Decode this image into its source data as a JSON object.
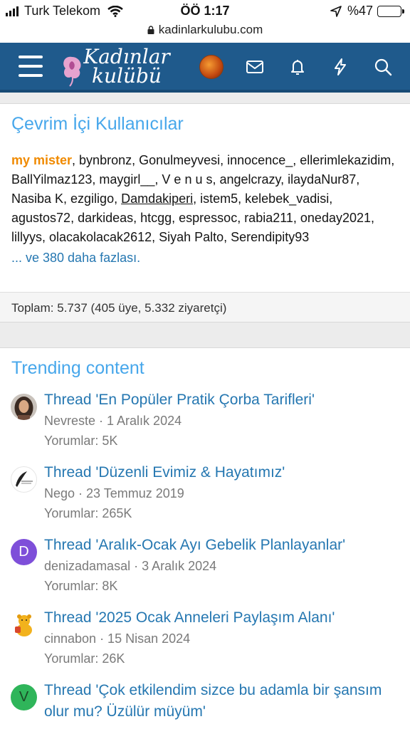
{
  "status_bar": {
    "carrier": "Turk Telekom",
    "time": "ÖÖ 1:17",
    "battery": "%47",
    "battery_level": 0.47
  },
  "browser": {
    "url": "kadinlarkulubu.com"
  },
  "header": {
    "logo_line1": "Kadınlar",
    "logo_line2": "kulübü",
    "icons": [
      "menu-icon",
      "inbox-icon",
      "bell-icon",
      "bolt-icon",
      "search-icon"
    ]
  },
  "online_users": {
    "title": "Çevrim İçi Kullanıcılar",
    "current_user": "my mister",
    "text_after_current": ", bynbronz, Gonulmeyvesi, innocence_, ellerimlekazidim, BallYilmaz123, maygirl__, V e n u s, angelcrazy, ilaydaNur87, Nasiba K, ezgiligo, ",
    "underlined_user": "Damdakiperi",
    "text_after_underlined": ", istem5, kelebek_vadisi, agustos72, darkideas, htcgg, espressoc, rabia211, oneday2021, lillyys, olacakolacak2612, Siyah Palto, Serendipity93",
    "more_link": "... ve 380 daha fazlası.",
    "total": "Toplam: 5.737 (405 üye, 5.332 ziyaretçi)"
  },
  "trending": {
    "title": "Trending content",
    "items": [
      {
        "title": "Thread 'En Popüler Pratik Çorba Tarifleri'",
        "meta": "Nevreste · 1 Aralık 2024",
        "replies": "Yorumlar: 5K",
        "avatar": "photo-avatar"
      },
      {
        "title": "Thread 'Düzenli Evimiz & Hayatımız'",
        "meta": "Nego · 23 Temmuz 2019",
        "replies": "Yorumlar: 265K",
        "avatar": "quill-avatar"
      },
      {
        "title": "Thread 'Aralık-Ocak Ayı Gebelik Planlayanlar'",
        "meta": "denizadamasal · 3 Aralık 2024",
        "replies": "Yorumlar: 8K",
        "avatar_letter": "D",
        "avatar_color": "#7e4fd9"
      },
      {
        "title": "Thread '2025 Ocak Anneleri Paylaşım Alanı'",
        "meta": "cinnabon · 15 Nisan 2024",
        "replies": "Yorumlar: 26K",
        "avatar": "bear-avatar"
      },
      {
        "title": "Thread 'Çok etkilendim sizce bu adamla bir şansım olur mu? Üzülür müyüm'",
        "avatar_letter": "V",
        "avatar_color": "#2fb55a"
      }
    ]
  },
  "colors": {
    "header": "#1f5a8c",
    "title_blue": "#47a7eb",
    "link_blue": "#2577b1",
    "username_orange": "#f08a00"
  }
}
